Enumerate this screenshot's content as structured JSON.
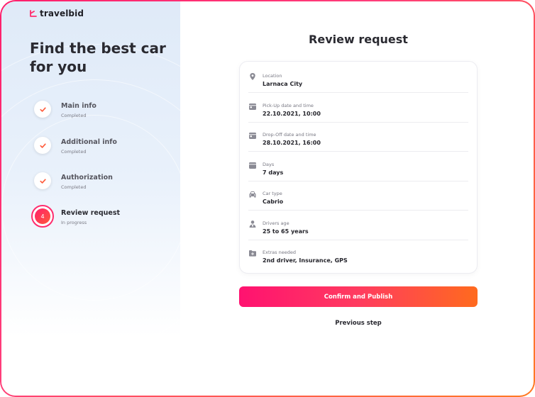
{
  "brand": {
    "name": "travelbid",
    "accent": "#ff2d6e",
    "accent_end": "#ff6a1e"
  },
  "sidebar": {
    "headline": "Find the best car for you",
    "steps": [
      {
        "number": "1",
        "title": "Main info",
        "status": "Completed",
        "state": "done"
      },
      {
        "number": "2",
        "title": "Additional info",
        "status": "Completed",
        "state": "done"
      },
      {
        "number": "3",
        "title": "Authorization",
        "status": "Completed",
        "state": "done"
      },
      {
        "number": "4",
        "title": "Review request",
        "status": "In progress",
        "state": "active"
      }
    ]
  },
  "main": {
    "title": "Review request",
    "details": [
      {
        "icon": "location-pin-icon",
        "label": "Location",
        "value": "Larnaca City"
      },
      {
        "icon": "calendar-icon",
        "label": "Pick-Up date and time",
        "value": "22.10.2021, 10:00"
      },
      {
        "icon": "calendar-icon",
        "label": "Drop-Off date and time",
        "value": "28.10.2021, 16:00"
      },
      {
        "icon": "calendar-days-icon",
        "label": "Days",
        "value": "7 days"
      },
      {
        "icon": "car-icon",
        "label": "Car type",
        "value": "Cabrio"
      },
      {
        "icon": "driver-icon",
        "label": "Drivers age",
        "value": "25 to 65 years"
      },
      {
        "icon": "extras-icon",
        "label": "Extras needed",
        "value": "2nd driver, Insurance, GPS"
      }
    ],
    "confirm_label": "Confirm and Publish",
    "previous_label": "Previous step"
  }
}
